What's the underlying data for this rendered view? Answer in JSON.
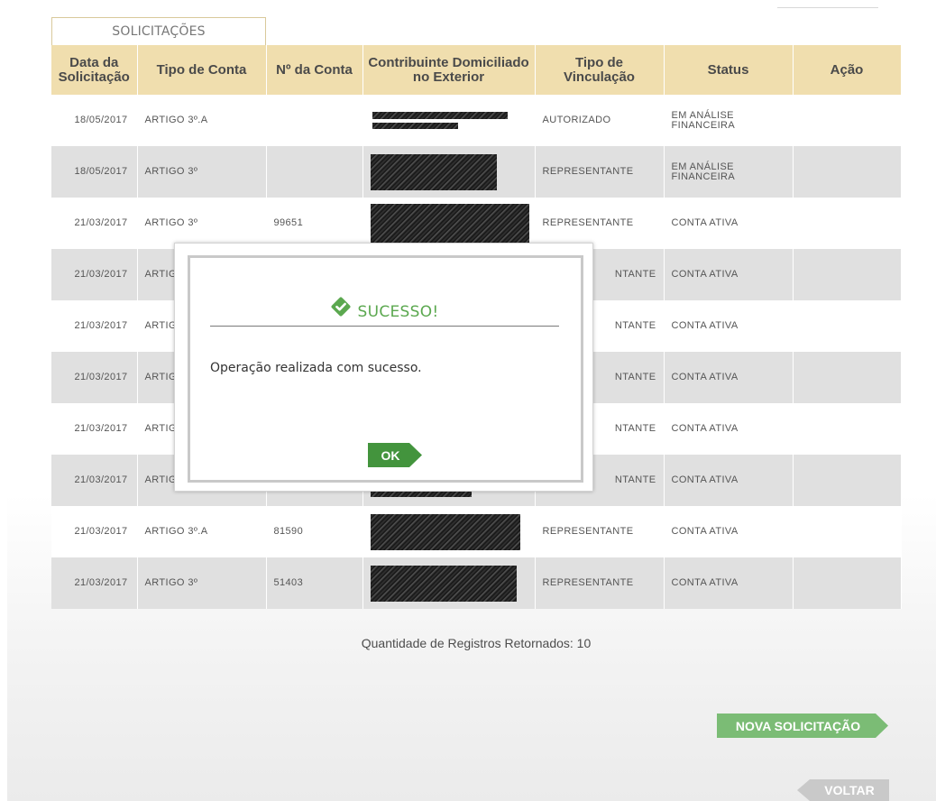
{
  "tab": {
    "label": "SOLICITAÇÕES"
  },
  "table": {
    "headers": {
      "date": "Data da Solicitação",
      "account_type": "Tipo de Conta",
      "account_number": "Nº da Conta",
      "taxpayer": "Contribuinte Domiciliado no Exterior",
      "link_type": "Tipo de Vinculação",
      "status": "Status",
      "action": "Ação"
    },
    "rows": [
      {
        "date": "18/05/2017",
        "account_type": "ARTIGO 3º.A",
        "account_number": "",
        "link_type": "AUTORIZADO",
        "status": "EM ANÁLISE FINANCEIRA"
      },
      {
        "date": "18/05/2017",
        "account_type": "ARTIGO 3º",
        "account_number": "",
        "link_type": "REPRESENTANTE",
        "status": "EM ANÁLISE FINANCEIRA"
      },
      {
        "date": "21/03/2017",
        "account_type": "ARTIGO 3º",
        "account_number": "99651",
        "link_type": "REPRESENTANTE",
        "status": "CONTA ATIVA"
      },
      {
        "date": "21/03/2017",
        "account_type": "ARTIG",
        "account_number": "",
        "link_type": "NTANTE",
        "status": "CONTA ATIVA"
      },
      {
        "date": "21/03/2017",
        "account_type": "ARTIG",
        "account_number": "",
        "link_type": "NTANTE",
        "status": "CONTA ATIVA"
      },
      {
        "date": "21/03/2017",
        "account_type": "ARTIG",
        "account_number": "",
        "link_type": "NTANTE",
        "status": "CONTA ATIVA"
      },
      {
        "date": "21/03/2017",
        "account_type": "ARTIG",
        "account_number": "",
        "link_type": "NTANTE",
        "status": "CONTA ATIVA"
      },
      {
        "date": "21/03/2017",
        "account_type": "ARTIG",
        "account_number": "",
        "link_type": "NTANTE",
        "status": "CONTA ATIVA"
      },
      {
        "date": "21/03/2017",
        "account_type": "ARTIGO 3º.A",
        "account_number": "81590",
        "link_type": "REPRESENTANTE",
        "status": "CONTA ATIVA"
      },
      {
        "date": "21/03/2017",
        "account_type": "ARTIGO 3º",
        "account_number": "51403",
        "link_type": "REPRESENTANTE",
        "status": "CONTA ATIVA"
      }
    ]
  },
  "footer": {
    "count_text": "Quantidade de Registros Retornados: 10",
    "new_request_label": "NOVA SOLICITAÇÃO",
    "back_label": "VOLTAR"
  },
  "modal": {
    "title": "SUCESSO!",
    "message": "Operação realizada com sucesso.",
    "ok_label": "OK",
    "icon": "check-icon"
  },
  "colors": {
    "header_bg": "#f0deae",
    "row_alt": "#e0e0e0",
    "success_green": "#5ba84f",
    "button_green": "#7bbc75",
    "ok_green": "#43943d"
  }
}
